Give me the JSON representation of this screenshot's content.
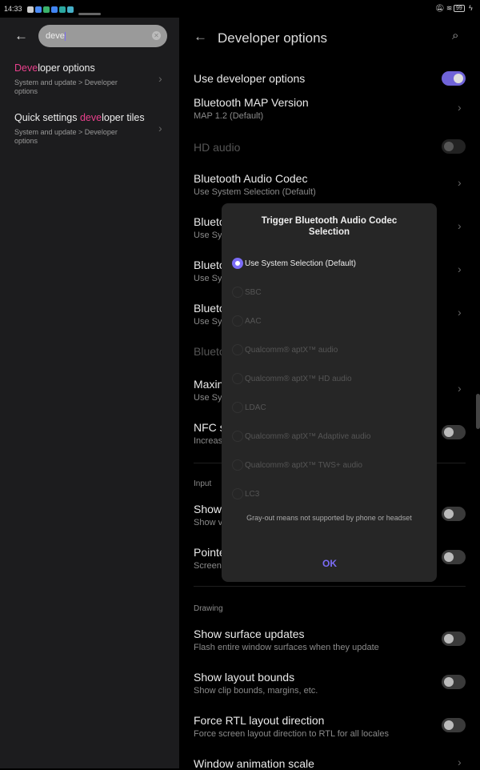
{
  "status": {
    "time": "14:33",
    "battery": "99"
  },
  "search": {
    "query": "deve"
  },
  "results": [
    {
      "pre": "",
      "match": "Deve",
      "post": "loper options",
      "path": "System and update > Developer options"
    },
    {
      "pre": "Quick settings ",
      "match": "deve",
      "post": "loper tiles",
      "path": "System and update > Developer options"
    }
  ],
  "header": {
    "title": "Developer options"
  },
  "settings": {
    "use_dev": "Use developer options",
    "bt_map": "Bluetooth MAP Version",
    "bt_map_val": "MAP 1.2 (Default)",
    "hd_audio": "HD audio",
    "bt_codec": "Bluetooth Audio Codec",
    "bt_codec_val": "Use System Selection (Default)",
    "r1": "Blueto",
    "r1s": "Use Sys",
    "r2": "Blueto",
    "r2s": "Use Sys",
    "r3": "Blueto",
    "r3s": "Use Sys",
    "r4": "Blueto",
    "r5": "Maxin",
    "r5s": "Use Sys",
    "r6": "NFC s",
    "r6s": "Increas",
    "input": "Input",
    "r7": "Show",
    "r7s": "Show v",
    "r8": "Pointe",
    "r8s": "Screen",
    "drawing": "Drawing",
    "surf": "Show surface updates",
    "surf_s": "Flash entire window surfaces when they update",
    "bounds": "Show layout bounds",
    "bounds_s": "Show clip bounds, margins, etc.",
    "rtl": "Force RTL layout direction",
    "rtl_s": "Force screen layout direction to RTL for all locales",
    "anim": "Window animation scale"
  },
  "dialog": {
    "title": "Trigger Bluetooth Audio Codec Selection",
    "options": [
      "Use System Selection (Default)",
      "SBC",
      "AAC",
      "Qualcomm® aptX™ audio",
      "Qualcomm® aptX™ HD audio",
      "LDAC",
      "Qualcomm® aptX™ Adaptive audio",
      "Qualcomm® aptX™ TWS+ audio",
      "LC3"
    ],
    "selected": 0,
    "note": "Gray-out means not supported by phone or headset",
    "ok": "OK"
  },
  "colors": {
    "accent": "#7b6cf6",
    "highlight": "#e8408c"
  }
}
